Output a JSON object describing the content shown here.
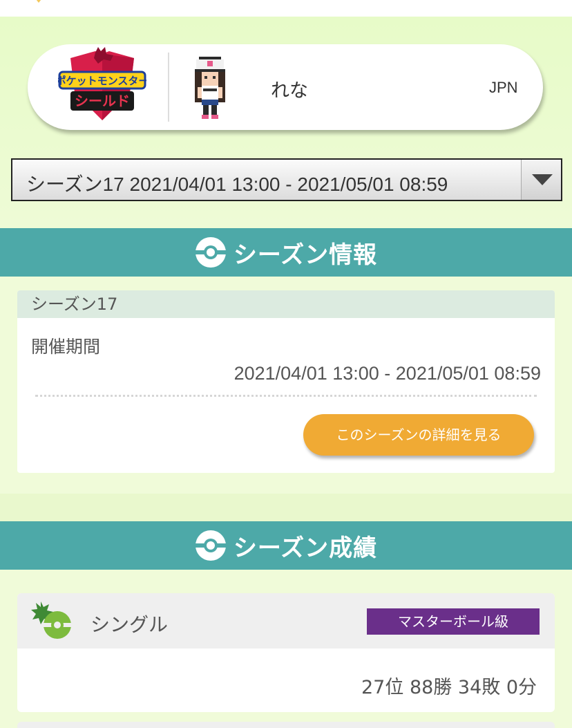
{
  "profile": {
    "game_logo_text_top": "ポケットモンスター",
    "game_logo_text_bottom": "シールド",
    "player_name": "れな",
    "country": "JPN"
  },
  "season_select": {
    "selected": "シーズン17 2021/04/01 13:00 - 2021/05/01 08:59"
  },
  "season_info": {
    "header": "シーズン情報",
    "card_title": "シーズン17",
    "period_label": "開催期間",
    "period_value": "2021/04/01 13:00 - 2021/05/01 08:59",
    "detail_button": "このシーズンの詳細を見る"
  },
  "season_results": {
    "header": "シーズン成績",
    "battle_type": "シングル",
    "rank_class": "マスターボール級",
    "record": "27位 88勝 34敗 0分"
  },
  "colors": {
    "header_teal": "#4da9a8",
    "button_orange": "#f0aa34",
    "badge_purple": "#6a2f8a",
    "background_green": "#f0fbd9"
  },
  "icons": {
    "section_icon": "pokeball-icon",
    "battle_icon": "single-battle-icon"
  }
}
